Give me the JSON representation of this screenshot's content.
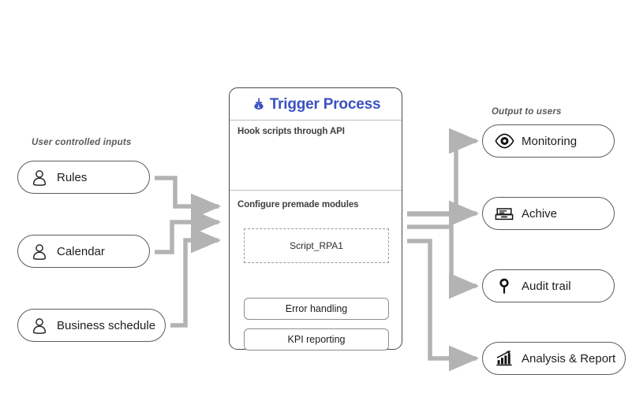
{
  "captions": {
    "inputs": "User controlled inputs",
    "outputs": "Output to users"
  },
  "inputs": [
    {
      "label": "Rules",
      "icon": "user-icon"
    },
    {
      "label": "Calendar",
      "icon": "user-icon"
    },
    {
      "label": "Business schedule",
      "icon": "user-icon"
    }
  ],
  "process": {
    "title": "Trigger Process",
    "title_color": "#3a51c0",
    "icon": "trigger-plug-icon",
    "section_api": {
      "heading": "Hook scripts through API",
      "script": "Script_RPA1"
    },
    "section_modules": {
      "heading": "Configure premade modules",
      "modules": [
        {
          "label": "Error handling"
        },
        {
          "label": "KPI reporting"
        }
      ]
    }
  },
  "outputs": [
    {
      "label": "Monitoring",
      "icon": "eye-icon"
    },
    {
      "label": "Achive",
      "icon": "archive-drawer-icon"
    },
    {
      "label": "Audit trail",
      "icon": "magnifier-pin-icon"
    },
    {
      "label": "Analysis & Report",
      "icon": "bar-chart-icon"
    }
  ],
  "colors": {
    "connector": "#b3b3b3",
    "node_border": "#5b5b5b",
    "card_border": "#4a4a4a",
    "caption": "#5a5a5a",
    "text": "#1d1d1d",
    "dashed_border": "#9a9a9a"
  }
}
